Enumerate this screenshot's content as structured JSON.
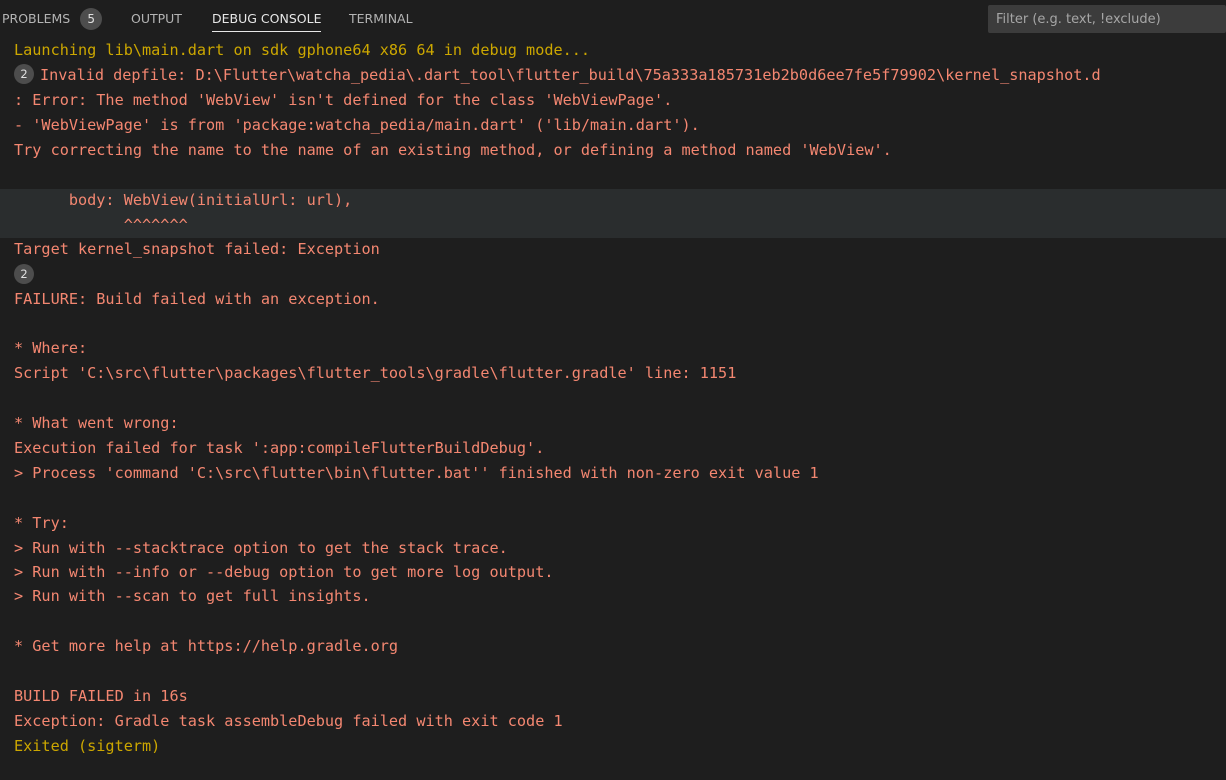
{
  "tabs": [
    {
      "label": "PROBLEMS",
      "badge": "5"
    },
    {
      "label": "OUTPUT"
    },
    {
      "label": "DEBUG CONSOLE",
      "active": true
    },
    {
      "label": "TERMINAL"
    }
  ],
  "filter": {
    "placeholder": "Filter (e.g. text, !exclude)"
  },
  "console": {
    "launch": "Launching lib\\main.dart on sdk gphone64 x86 64 in debug mode...",
    "depfile_count": "2",
    "depfile": "Invalid depfile: D:\\Flutter\\watcha_pedia\\.dart_tool\\flutter_build\\75a333a185731eb2b0d6ee7fe5f79902\\kernel_snapshot.d",
    "error1": ": Error: The method 'WebView' isn't defined for the class 'WebViewPage'.",
    "error2": "- 'WebViewPage' is from 'package:watcha_pedia/main.dart' ('lib/main.dart').",
    "error3": "Try correcting the name to the name of an existing method, or defining a method named 'WebView'.",
    "code": "      body: WebView(initialUrl: url),",
    "caret": "            ^^^^^^^",
    "target": "Target kernel_snapshot failed: Exception",
    "repeat_count": "2",
    "failure": "FAILURE: Build failed with an exception.",
    "where_head": "* Where:",
    "where_body": "Script 'C:\\src\\flutter\\packages\\flutter_tools\\gradle\\flutter.gradle' line: 1151",
    "wrong_head": "* What went wrong:",
    "wrong_body1": "Execution failed for task ':app:compileFlutterBuildDebug'.",
    "wrong_body2": "> Process 'command 'C:\\src\\flutter\\bin\\flutter.bat'' finished with non-zero exit value 1",
    "try_head": "* Try:",
    "try1": "> Run with --stacktrace option to get the stack trace.",
    "try2": "> Run with --info or --debug option to get more log output.",
    "try3": "> Run with --scan to get full insights.",
    "help": "* Get more help at https://help.gradle.org",
    "build_failed": "BUILD FAILED in 16s",
    "exception": "Exception: Gradle task assembleDebug failed with exit code 1",
    "exited": "Exited (sigterm)"
  },
  "colors": {
    "background": "#1e1e1e",
    "warning": "#cca700",
    "error": "#f48771",
    "highlight": "#2a2d2e",
    "badge": "#4d4d4d"
  }
}
